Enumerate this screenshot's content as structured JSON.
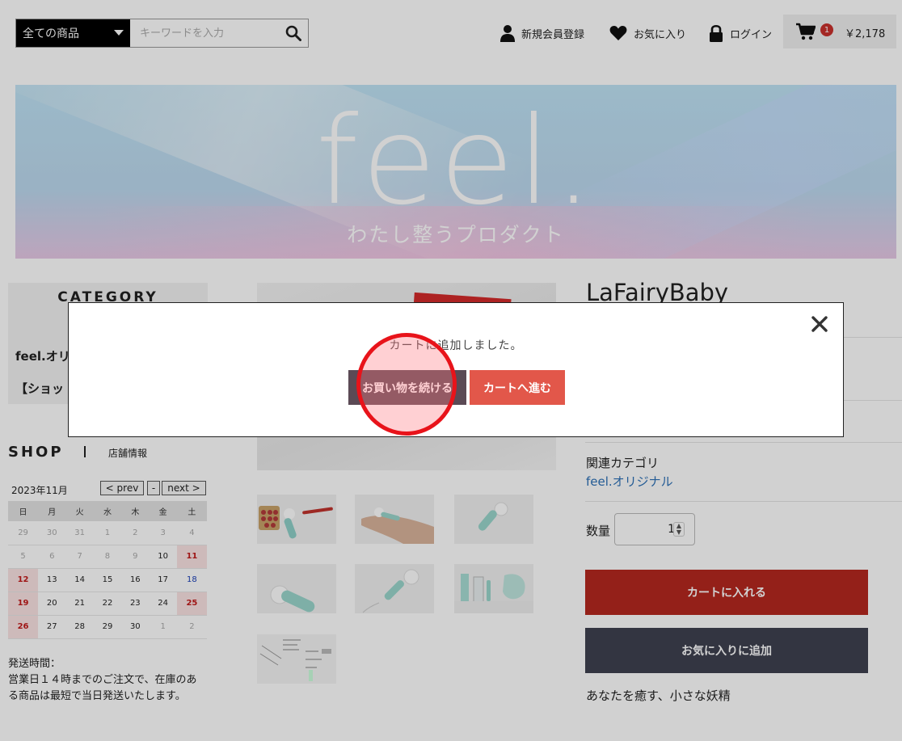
{
  "header": {
    "category_select": "全ての商品",
    "search_placeholder": "キーワードを入力",
    "nav": {
      "register": "新規会員登録",
      "favorites": "お気に入り",
      "login": "ログイン"
    },
    "cart": {
      "count": "1",
      "total": "￥2,178"
    }
  },
  "banner": {
    "title": "feel.",
    "subtitle": "わたし整うプロダクト"
  },
  "sidebar": {
    "category_title": "CATEGORY",
    "category_items": [
      "feel.オリ",
      "【ショッ"
    ],
    "shop_title": "SHOP",
    "shop_info_link": "店舗情報",
    "calendar": {
      "month": "2023年11月",
      "prev": "< prev",
      "dash": "-",
      "next": "next >",
      "weekdays": [
        "日",
        "月",
        "火",
        "水",
        "木",
        "金",
        "土"
      ],
      "weeks": [
        [
          "29",
          "30",
          "31",
          "1",
          "2",
          "3",
          "4"
        ],
        [
          "5",
          "6",
          "7",
          "8",
          "9",
          "10",
          "11"
        ],
        [
          "12",
          "13",
          "14",
          "15",
          "16",
          "17",
          "18"
        ],
        [
          "19",
          "20",
          "21",
          "22",
          "23",
          "24",
          "25"
        ],
        [
          "26",
          "27",
          "28",
          "29",
          "30",
          "1",
          "2"
        ]
      ]
    },
    "shipping_text": "発送時間：\n営業日１４時までのご注文で、在庫のある商品は最短で当日発送いたします。"
  },
  "product": {
    "title": "LaFairyBaby",
    "related_label": "関連カテゴリ",
    "related_link": "feel.オリジナル",
    "quantity_label": "数量",
    "quantity_value": "1",
    "add_to_cart": "カートに入れる",
    "add_to_favorites": "お気に入りに追加",
    "catch_copy": "あなたを癒す、小さな妖精"
  },
  "modal": {
    "message": "カートに追加しました。",
    "continue_button": "お買い物を続ける",
    "to_cart_button": "カートへ進む"
  },
  "colors": {
    "cart_button": "#b5281f",
    "favorite_button": "#3f4150",
    "continue_button": "#5b4a55",
    "to_cart_button": "#e2574a",
    "click_highlight": "#e8131a"
  }
}
